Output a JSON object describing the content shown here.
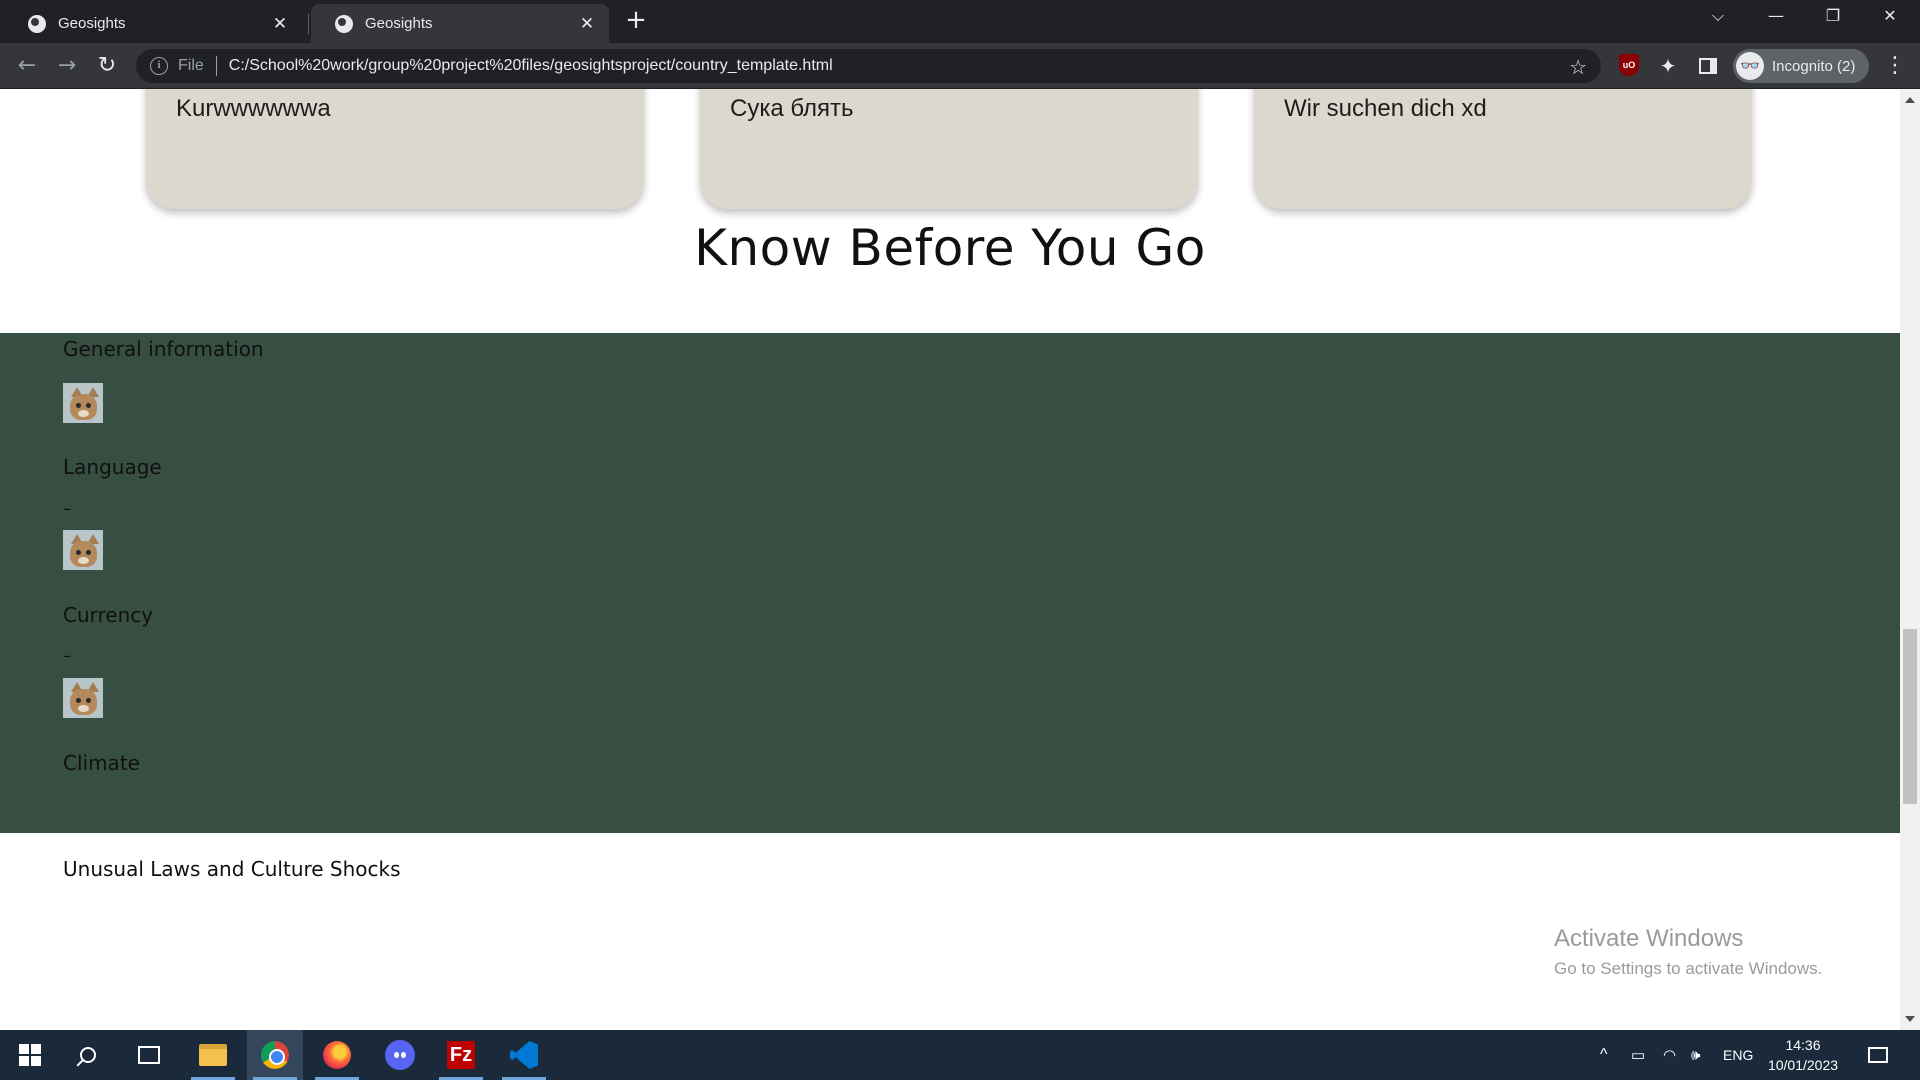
{
  "browser": {
    "tabs": [
      {
        "title": "Geosights",
        "active": false
      },
      {
        "title": "Geosights",
        "active": true
      }
    ],
    "new_tab_label": "+",
    "tab_close_glyph": "✕",
    "controls": {
      "tab_search": "⌵",
      "minimize": "—",
      "restore": "❐",
      "close": "✕"
    },
    "nav": {
      "back": "←",
      "forward": "→",
      "reload": "↻"
    },
    "address": {
      "scheme_label": "File",
      "url": "C:/School%20work/group%20project%20files/geosightsproject/country_template.html"
    },
    "extensions": {
      "ublock": "uO",
      "puzzle_glyph": "✦",
      "bookmark_glyph": "☆",
      "menu_glyph": "⋮"
    },
    "profile": {
      "label": "Incognito (2)",
      "avatar_glyph": "👓"
    }
  },
  "page": {
    "cards": [
      {
        "text": "Kurwwwwwwa"
      },
      {
        "text": "Сука блять"
      },
      {
        "text": "Wir suchen dich xd"
      }
    ],
    "know_before_title": "Know Before You Go",
    "know_before": {
      "general_heading": "General information",
      "language_heading": "Language",
      "language_dash": "–",
      "currency_heading": "Currency",
      "currency_dash": "–",
      "climate_heading": "Climate"
    },
    "unusual_heading": "Unusual Laws and Culture Shocks",
    "colors": {
      "card_bg": "#dcd8cd",
      "section_bg": "#364f42"
    }
  },
  "watermark": {
    "title": "Activate Windows",
    "subtitle": "Go to Settings to activate Windows."
  },
  "taskbar": {
    "apps": [
      "start-icon",
      "search-icon",
      "task-view-icon",
      "file-explorer-icon",
      "chrome-icon",
      "firefox-icon",
      "discord-icon",
      "filezilla-icon",
      "vscode-icon"
    ],
    "filezilla_glyph": "Fz",
    "tray": {
      "chevron": "^",
      "battery_glyph": "▭",
      "wifi_glyph": "◠",
      "volume_glyph": "🕪",
      "language": "ENG",
      "time": "14:36",
      "date": "10/01/2023"
    }
  }
}
